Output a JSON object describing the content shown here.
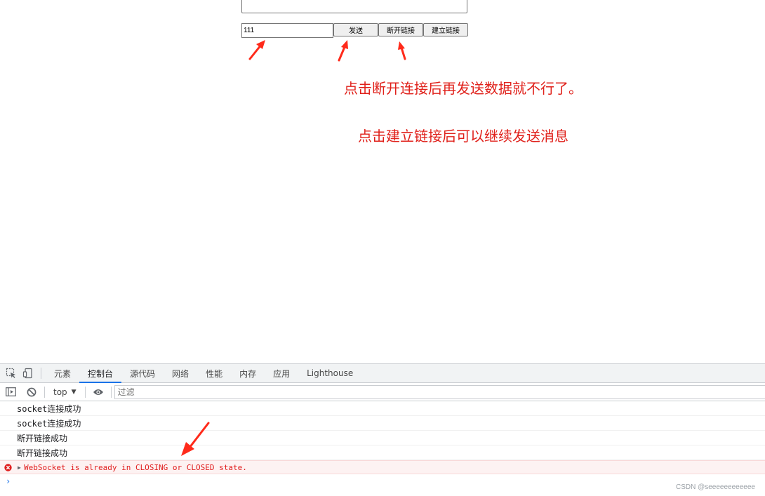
{
  "page": {
    "input_value": "111",
    "send_label": "发送",
    "disconnect_label": "断开链接",
    "connect_label": "建立链接",
    "note1": "点击断开连接后再发送数据就不行了。",
    "note2": "点击建立链接后可以继续发送消息"
  },
  "devtools": {
    "tabs": [
      {
        "label": "元素"
      },
      {
        "label": "控制台",
        "active": true
      },
      {
        "label": "源代码"
      },
      {
        "label": "网络"
      },
      {
        "label": "性能"
      },
      {
        "label": "内存"
      },
      {
        "label": "应用"
      },
      {
        "label": "Lighthouse"
      }
    ],
    "context": "top",
    "filter_placeholder": "过滤",
    "logs": [
      {
        "text": "socket连接成功"
      },
      {
        "text": "socket连接成功"
      },
      {
        "text": "断开链接成功"
      },
      {
        "text": "断开链接成功"
      }
    ],
    "error": "WebSocket is already in CLOSING or CLOSED state."
  },
  "watermark": "CSDN @seeeeeeeeeeee",
  "colors": {
    "annotation": "#e0211b",
    "error_text": "#e01e1e",
    "error_bg": "#fdf2f2",
    "active_tab": "#1a73e8"
  }
}
